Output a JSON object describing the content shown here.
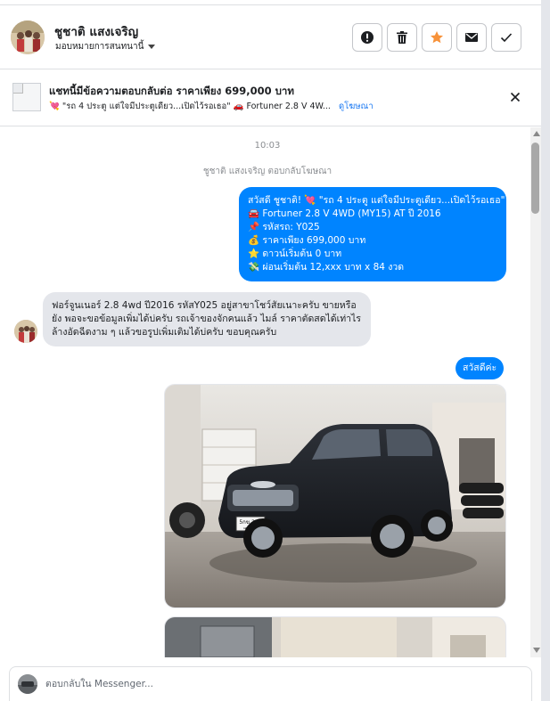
{
  "header": {
    "contact_name": "ชูชาติ แสงเจริญ",
    "assign_label": "มอบหมายการสนทนานี้",
    "actions": [
      {
        "name": "alert-button",
        "icon": "exclamation-icon"
      },
      {
        "name": "delete-button",
        "icon": "trash-icon"
      },
      {
        "name": "star-button",
        "icon": "star-icon"
      },
      {
        "name": "mail-button",
        "icon": "envelope-icon"
      },
      {
        "name": "done-button",
        "icon": "checkmark-icon"
      }
    ],
    "star_color": "#f7923a"
  },
  "ad_banner": {
    "title": "แชทนี้มีข้อความตอบกลับต่อ ราคาเพียง 699,000 บาท",
    "subtitle": "💘 \"รถ 4 ประตู แต่ใจมีประตูเดียว...เปิดไว้รอเธอ\" 🚗 Fortuner 2.8 V 4W...",
    "link": "ดูโฆษณา"
  },
  "chat": {
    "time": "10:03",
    "system_note": "ชูชาติ แสงเจริญ ตอบกลับโฆษณา",
    "promo_lines": [
      "สวัสดี ชูชาติ! 💘 \"รถ 4 ประตู แต่ใจมีประตูเดียว...เปิดไว้รอเธอ\"",
      "🚘 Fortuner 2.8 V 4WD (MY15) AT ปี 2016",
      "📌 รหัสรถ: Y025",
      "💰 ราคาเพียง 699,000 บาท",
      "⭐ ดาวน์เริ่มต้น 0 บาท",
      "💸 ผ่อนเริ่มต้น 12,xxx บาท x 84 งวด"
    ],
    "incoming_reply": "ฟอร์จูนเนอร์ 2.8 4wd ปี2016 รหัสY025 อยู่สาขาโชว์สัยเนาะครับ  ขายหรือยัง พอจะขอข้อมูลเพิ่มได้บ่ครับ  รถเจ้าของจักคนแล้ว  ไมล์  ราคาตัดสดได้เท่าไร ล้างอัดฉีดงาม ๆ แล้วขอรูปเพิ่มเติมได้บ่ครับ ขอบคุณครับ",
    "outgoing_hello": "สวัสดีค่ะ",
    "car_plate_line1": "5กฆ 226",
    "car_plate_line2": "นครราชสีมา"
  },
  "composer": {
    "placeholder": "ตอบกลับใน Messenger..."
  },
  "colors": {
    "outgoing_bubble": "#0084ff",
    "incoming_bubble": "#e4e6eb",
    "link": "#1877f2"
  }
}
